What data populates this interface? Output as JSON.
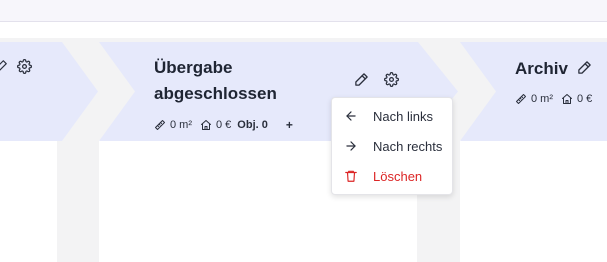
{
  "columns": [
    {
      "id": "left-partial",
      "icons": [
        "gear-icon"
      ]
    },
    {
      "id": "uebergabe",
      "title_line1": "Übergabe",
      "title_line2": "abgeschlossen",
      "area": "0 m²",
      "price": "0 €",
      "objects": "Obj. 0",
      "add": "+",
      "icons": [
        "pencil-icon",
        "gear-icon"
      ]
    },
    {
      "id": "archiv",
      "title": "Archiv",
      "area": "0 m²",
      "price": "0 €",
      "icons": [
        "pencil-icon"
      ]
    }
  ],
  "context_menu": {
    "items": [
      {
        "label": "Nach links",
        "icon": "arrow-left-icon"
      },
      {
        "label": "Nach rechts",
        "icon": "arrow-right-icon"
      },
      {
        "label": "Löschen",
        "icon": "trash-icon",
        "color": "#dc2626"
      }
    ]
  },
  "colors": {
    "header_fill": "#e6e9fb",
    "page_background": "#f3f3f4",
    "column_background": "#ffffff",
    "danger": "#dc2626"
  }
}
